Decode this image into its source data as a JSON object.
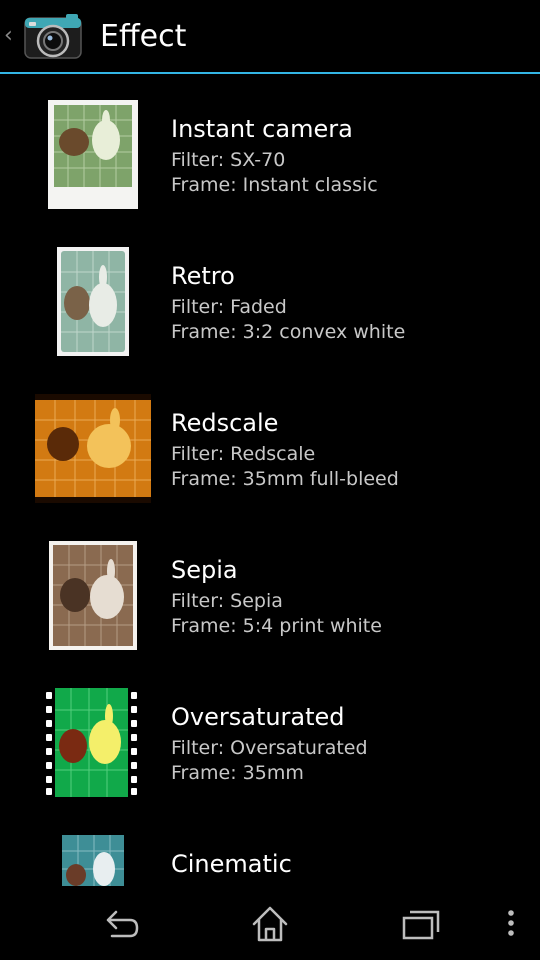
{
  "header": {
    "title": "Effect"
  },
  "effects": [
    {
      "name": "Instant camera",
      "filter": "Filter: SX-70",
      "frame": "Frame: Instant classic"
    },
    {
      "name": "Retro",
      "filter": "Filter: Faded",
      "frame": "Frame: 3:2 convex white"
    },
    {
      "name": "Redscale",
      "filter": "Filter: Redscale",
      "frame": "Frame: 35mm full-bleed"
    },
    {
      "name": "Sepia",
      "filter": "Filter: Sepia",
      "frame": "Frame: 5:4 print white"
    },
    {
      "name": "Oversaturated",
      "filter": "Filter: Oversaturated",
      "frame": "Frame: 35mm"
    },
    {
      "name": "Cinematic"
    }
  ],
  "colors": {
    "accent": "#33b5e5",
    "secondary_text": "#c8c8c8"
  },
  "icons": {
    "up": "back-caret-icon",
    "app": "camera-app-icon",
    "back": "back-icon",
    "home": "home-icon",
    "recents": "recent-apps-icon",
    "menu": "overflow-menu-icon"
  }
}
